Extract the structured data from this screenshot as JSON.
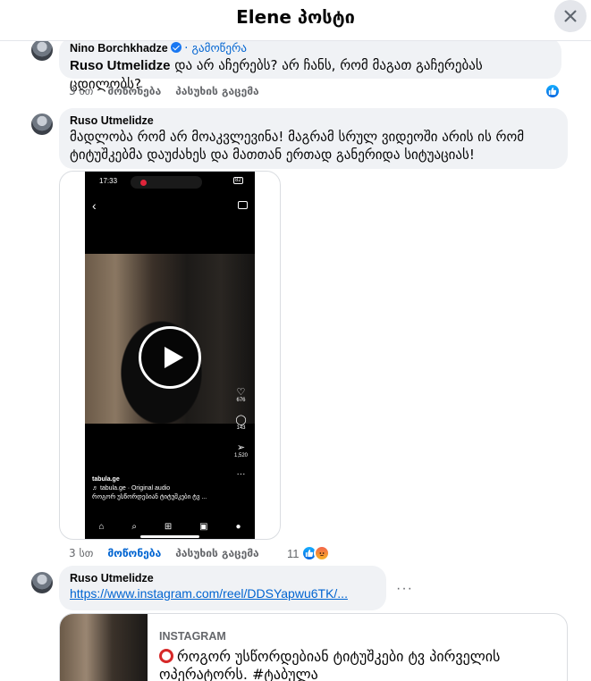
{
  "header": {
    "title": "Elene პოსტი"
  },
  "comments": [
    {
      "author": "Nino Borchkhadze",
      "follow_label": "· გამოწერა",
      "mention": "Ruso Utmelidze",
      "text": " და არ აჩერებს? არ ჩანს, რომ მაგათ გაჩერებას ცდილობს?",
      "time": "3 სთ",
      "like_label": "მოწონება",
      "reply_label": "პასუხის გაცემა"
    },
    {
      "author": "Ruso Utmelidze",
      "text": "მადლობა რომ არ მოაკვლევინა! მაგრამ სრულ ვიდეოში არის ის რომ ტიტუშკებმა დაუძახეს და მათთან ერთად განერიდა სიტუაციას!",
      "time": "3 სთ",
      "like_label": "მოწონება",
      "reply_label": "პასუხის გაცემა",
      "reaction_count": "11",
      "video": {
        "status_time": "17:33",
        "battery": "82",
        "handle": "tabula.ge",
        "audio": "♬ tabula.ge · Original audio",
        "caption": "როგორ უსწორდებიან ტიტუშკები ტვ ...",
        "likes": "676",
        "comments": "143",
        "shares": "1,520"
      }
    },
    {
      "author": "Ruso Utmelidze",
      "link": "https://www.instagram.com/reel/DDSYapwu6TK/...",
      "more": "···",
      "preview": {
        "source": "INSTAGRAM",
        "title": "როგორ უსწორდებიან ტიტუშკები ტვ პირველის ოპერატორს. #ტაბულა"
      }
    }
  ],
  "colors": {
    "link": "#0064d1",
    "bubble": "#f0f2f5",
    "like_blue": "#1877f2",
    "muted": "#65676b"
  }
}
